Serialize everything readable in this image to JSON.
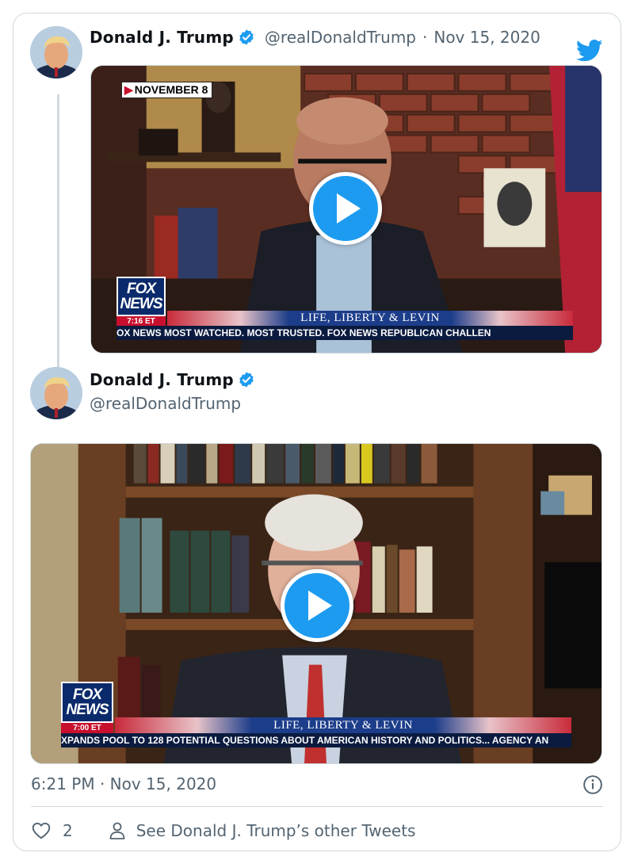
{
  "tweet1": {
    "name": "Donald J. Trump",
    "handle": "@realDonaldTrump",
    "separator": "·",
    "date": "Nov 15, 2020",
    "video": {
      "date_tag": "NOVEMBER 8",
      "logo_line1": "FOX",
      "logo_line2": "NEWS",
      "time": "7:16 ET",
      "show": "LIFE, LIBERTY & LEVIN",
      "ticker": "OX NEWS   MOST WATCHED. MOST TRUSTED.    FOX NEWS              REPUBLICAN CHALLEN"
    }
  },
  "tweet2": {
    "name": "Donald J. Trump",
    "handle": "@realDonaldTrump",
    "video": {
      "logo_line1": "FOX",
      "logo_line2": "NEWS",
      "time": "7:00 ET",
      "show": "LIFE, LIBERTY & LEVIN",
      "ticker": "XPANDS POOL TO 128 POTENTIAL QUESTIONS ABOUT AMERICAN HISTORY AND POLITICS...  AGENCY AN"
    }
  },
  "footer": {
    "timestamp": "6:21 PM · Nov 15, 2020",
    "likes": "2",
    "other_tweets": "See Donald J. Trump’s other Tweets"
  },
  "colors": {
    "twitter_blue": "#1d9bf0",
    "text_secondary": "#536471",
    "border": "#cfd9de"
  },
  "icons": [
    "twitter-bird-icon",
    "verified-badge-icon",
    "play-icon",
    "info-icon",
    "heart-icon",
    "person-icon"
  ]
}
